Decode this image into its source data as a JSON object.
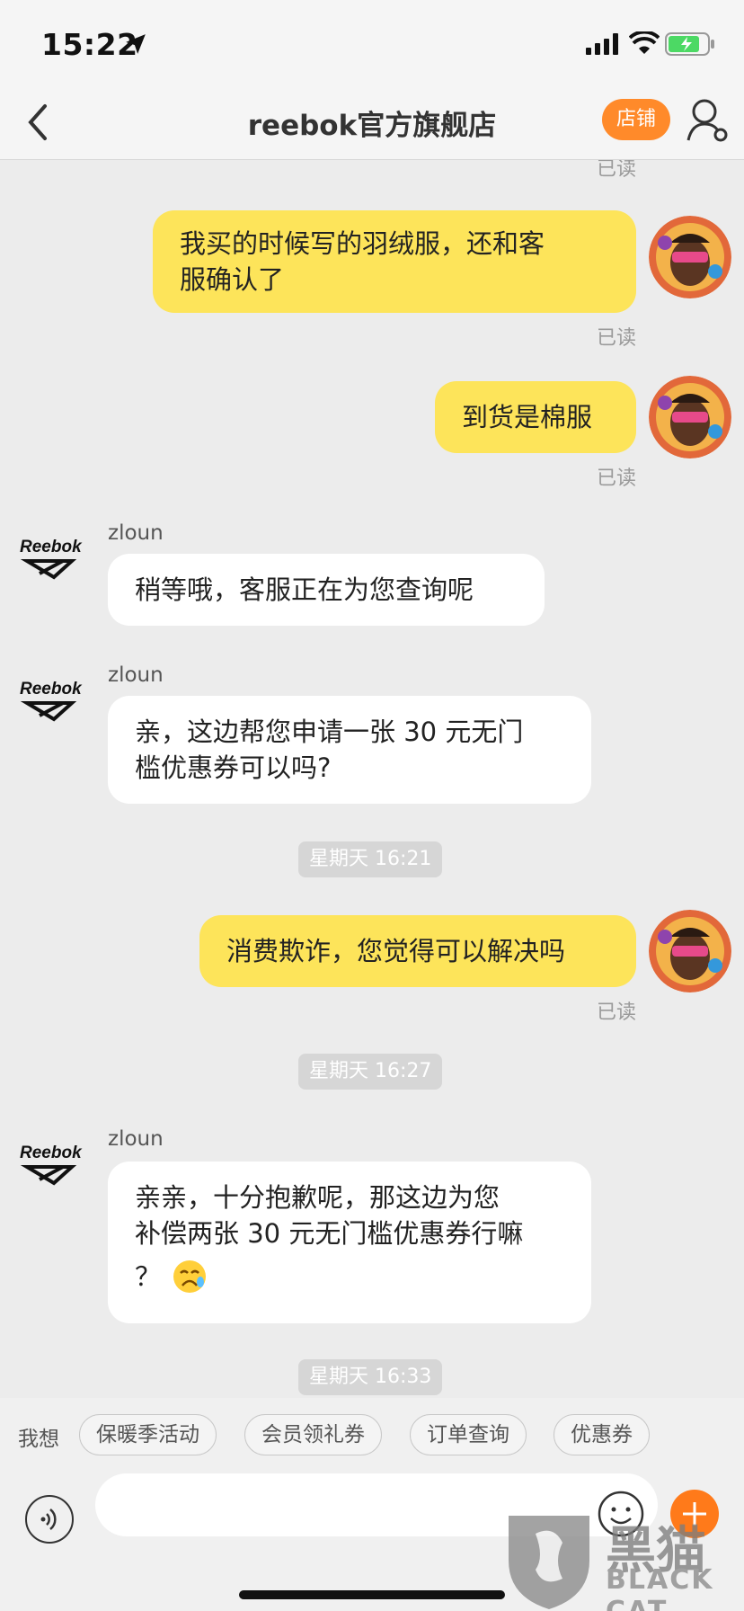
{
  "status_bar": {
    "time": "15:22"
  },
  "nav": {
    "title": "reebok官方旗舰店",
    "shop_label": "店铺"
  },
  "messages": [
    {
      "sender": "me",
      "text_line1": "我买的时候写的羽绒服，还和客",
      "text_line2": "服确认了",
      "read": "已读"
    },
    {
      "sender": "me",
      "text": "到货是棉服",
      "read": "已读"
    },
    {
      "sender": "shop",
      "name": "zloun",
      "text": "稍等哦，客服正在为您查询呢"
    },
    {
      "sender": "shop",
      "name": "zloun",
      "text_line1": "亲，这边帮您申请一张 30 元无门",
      "text_line2": "槛优惠券可以吗?"
    },
    {
      "sender": "me",
      "text": "消费欺诈，您觉得可以解决吗",
      "read": "已读"
    },
    {
      "sender": "shop",
      "name": "zloun",
      "text_line1": "亲亲，十分抱歉呢，那这边为您",
      "text_line2": "补偿两张 30 元无门槛优惠券行嘛",
      "text_line3": "？"
    }
  ],
  "top_read": "已读",
  "timestamps": [
    "星期天 16:21",
    "星期天 16:27",
    "星期天 16:33"
  ],
  "shop_logo_text": "Reebok",
  "quick_bar": {
    "label": "我想",
    "chips": [
      "保暖季活动",
      "会员领礼券",
      "订单查询",
      "优惠券"
    ]
  },
  "input": {
    "placeholder": ""
  },
  "watermark": {
    "cn": "黑猫",
    "en": "BLACK CAT"
  }
}
